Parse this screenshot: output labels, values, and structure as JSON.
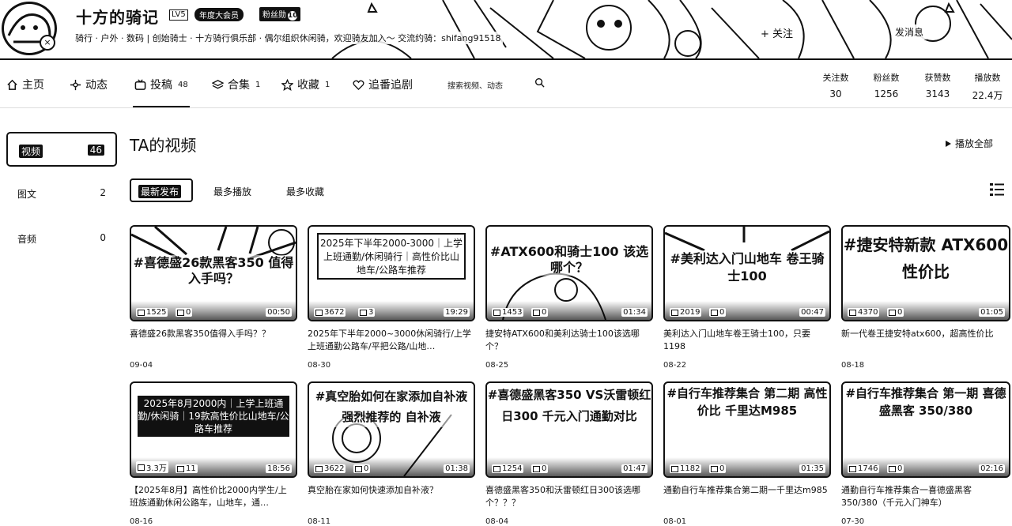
{
  "user": {
    "name": "十方的骑记",
    "level": "LV5",
    "vip_badge": "年度大会员",
    "medal_label": "粉丝勋",
    "medal_level": "10",
    "signature": "骑行 · 户外 · 数码 | 创始骑士 · 十方骑行俱乐部 · 偶尔组织休闲骑，欢迎骑友加入～ 交流约骑：shifang91518",
    "follow_label": "+ 关注",
    "message_label": "发消息"
  },
  "nav": {
    "home": "主页",
    "dynamic": "动态",
    "posts": "投稿",
    "posts_count": "48",
    "collections": "合集",
    "collections_count": "1",
    "favorites": "收藏",
    "favorites_count": "1",
    "bangumi": "追番追剧",
    "search_placeholder": "搜索视频、动态"
  },
  "stats": [
    {
      "label": "关注数",
      "value": "30"
    },
    {
      "label": "粉丝数",
      "value": "1256"
    },
    {
      "label": "获赞数",
      "value": "3143"
    },
    {
      "label": "播放数",
      "value": "22.4万"
    }
  ],
  "sidebar": [
    {
      "label": "视频",
      "count": "46"
    },
    {
      "label": "图文",
      "count": "2"
    },
    {
      "label": "音频",
      "count": "0"
    }
  ],
  "section": {
    "title": "TA的视频",
    "play_all": "播放全部"
  },
  "sort_tabs": [
    "最新发布",
    "最多播放",
    "最多收藏"
  ],
  "videos": [
    {
      "cover": "#喜德盛26款黑客350 值得入手吗？",
      "plays": "1525",
      "comments": "0",
      "duration": "00:50",
      "title": "喜德盛26款黑客350值得入手吗？？",
      "date": "09-04"
    },
    {
      "cover": "2025年下半年2000-3000｜上学上班通勤/休闲骑行｜高性价比山地车/公路车推荐",
      "plays": "3672",
      "comments": "3",
      "duration": "19:29",
      "title": "2025年下半年2000~3000休闲骑行/上学上班通勤公路车/平把公路/山地…",
      "date": "08-30"
    },
    {
      "cover": "#ATX600和骑士100 该选哪个？",
      "plays": "1453",
      "comments": "0",
      "duration": "01:34",
      "title": "捷安特ATX600和美利达骑士100该选哪个？",
      "date": "08-25"
    },
    {
      "cover": "#美利达入门山地车 卷王骑士100",
      "plays": "2019",
      "comments": "0",
      "duration": "00:47",
      "title": "美利达入门山地车卷王骑士100，只要1198",
      "date": "08-22"
    },
    {
      "cover": "#捷安特新款 ATX600 性价比",
      "plays": "4370",
      "comments": "0",
      "duration": "01:05",
      "title": "新一代卷王捷安特atx600，超高性价比",
      "date": "08-18"
    },
    {
      "cover": "2025年8月2000内｜上学上班通勤/休闲骑｜19款高性价比山地车/公路车推荐",
      "plays": "3.3万",
      "comments": "11",
      "duration": "18:56",
      "title": "【2025年8月】高性价比2000内学生/上班族通勤休闲公路车，山地车，通…",
      "date": "08-16"
    },
    {
      "cover": "#真空胎如何在家添加自补液 强烈推荐的 自补液",
      "plays": "3622",
      "comments": "0",
      "duration": "01:38",
      "title": "真空胎在家如何快速添加自补液？",
      "date": "08-11"
    },
    {
      "cover": "#喜德盛黑客350 VS沃雷顿红日300 千元入门通勤对比",
      "plays": "1254",
      "comments": "0",
      "duration": "01:47",
      "title": "喜德盛黑客350和沃雷顿红日300该选哪个？？？",
      "date": "08-04"
    },
    {
      "cover": "#自行车推荐集合 第二期 高性价比 千里达M985",
      "plays": "1182",
      "comments": "0",
      "duration": "01:35",
      "title": "通勤自行车推荐集合第二期一千里达m985",
      "date": "08-01"
    },
    {
      "cover": "#自行车推荐集合 第一期 喜德盛黑客 350/380",
      "plays": "1746",
      "comments": "0",
      "duration": "02:16",
      "title": "通勤自行车推荐集合一喜德盛黑客350/380（千元入门神车）",
      "date": "07-30"
    }
  ]
}
